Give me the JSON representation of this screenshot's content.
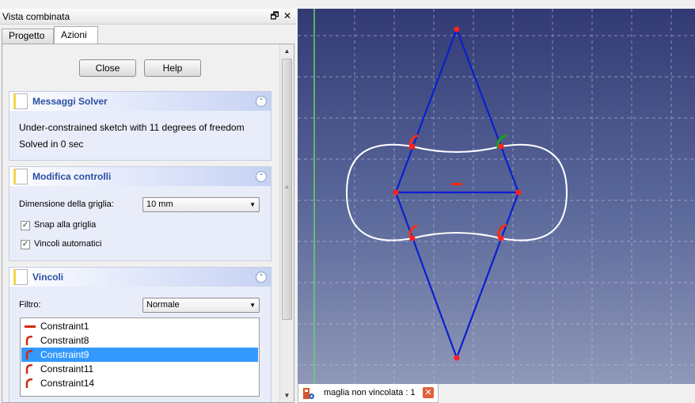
{
  "dock": {
    "title": "Vista combinata",
    "float_glyph": "🗗",
    "close_glyph": "✕",
    "tabs": [
      {
        "label": "Progetto",
        "active": false
      },
      {
        "label": "Azioni",
        "active": true
      }
    ]
  },
  "actions": {
    "close_label": "Close",
    "help_label": "Help"
  },
  "panels": {
    "messaggi": {
      "title": "Messaggi Solver",
      "line1": "Under-constrained sketch with 11 degrees of freedom",
      "line2": "Solved in 0 sec"
    },
    "modifica": {
      "title": "Modifica controlli",
      "grid_label": "Dimensione della griglia:",
      "grid_value": "10 mm",
      "snap_label": "Snap alla griglia",
      "snap_checked": true,
      "auto_label": "Vincoli automatici",
      "auto_checked": true
    },
    "vincoli": {
      "title": "Vincoli",
      "filter_label": "Filtro:",
      "filter_value": "Normale",
      "constraints": [
        {
          "label": "Constraint1",
          "icon": "horizontal-constraint-icon",
          "selected": false
        },
        {
          "label": "Constraint8",
          "icon": "tangent-constraint-icon",
          "selected": false
        },
        {
          "label": "Constraint9",
          "icon": "tangent-constraint-icon",
          "selected": true
        },
        {
          "label": "Constraint11",
          "icon": "tangent-constraint-icon",
          "selected": false
        },
        {
          "label": "Constraint14",
          "icon": "tangent-constraint-icon",
          "selected": false
        }
      ]
    }
  },
  "view": {
    "document_tab_label": "maglia non vincolata : 1",
    "tab_close_glyph": "✕",
    "colors": {
      "sketch_line": "#0a1fd0",
      "profile": "#ffffff",
      "vertex": "#ff2020",
      "constraint_red": "#ff2a10",
      "constraint_green": "#1aa51a",
      "axis": "#6fd35a"
    }
  }
}
